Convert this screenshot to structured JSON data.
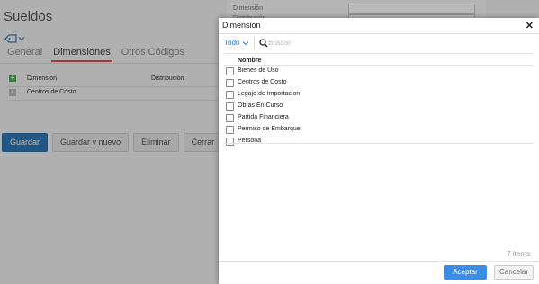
{
  "page": {
    "title": "Sueldos",
    "tabs": [
      "General",
      "Dimensiones",
      "Otros Códigos"
    ],
    "grid": {
      "headers": [
        "Dimensión",
        "Distribución"
      ],
      "rows": [
        {
          "dimension": "Centros de Costo",
          "distribucion": ""
        }
      ]
    },
    "buttons": {
      "save": "Guardar",
      "save_new": "Guardar y nuevo",
      "delete": "Eliminar",
      "close": "Cerrar"
    },
    "right_panel": {
      "field_label": "Dimensión",
      "field_label2": "Distribución"
    }
  },
  "modal": {
    "title": "Dimension",
    "close_glyph": "✕",
    "filter": {
      "selected": "Todo"
    },
    "search": {
      "placeholder": "Buscar",
      "value": ""
    },
    "column_header": "Nombre",
    "items": [
      "Bienes de Uso",
      "Centros de Costo",
      "Legajo de Importacion",
      "Obras En Curso",
      "Partida Financiera",
      "Permiso de Embarque",
      "Persona"
    ],
    "count_text": "7 items",
    "accept_label": "Aceptar",
    "cancel_label": "Cancelar"
  },
  "colors": {
    "accent": "#3b8ee3",
    "primary_button": "#337ab7",
    "active_tab_underline": "#d9534f",
    "add_icon": "#4caf50"
  },
  "icons": [
    "tag-icon",
    "chevron-down-icon",
    "add-icon",
    "remove-icon",
    "close-icon",
    "search-icon"
  ]
}
